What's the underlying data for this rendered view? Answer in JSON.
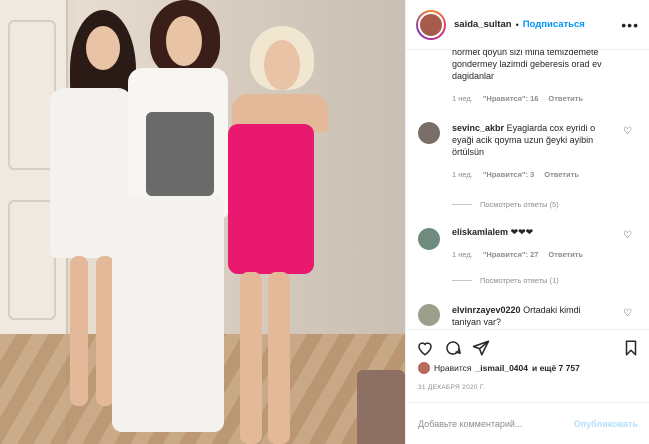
{
  "post": {
    "username": "saida_sultan",
    "follow_label": "Подписаться",
    "more_icon": "ellipsis-icon"
  },
  "comments": [
    {
      "text": "hormet qoyun sizi mina temizdemete gondermey lazimdi geberesis orad ev dagidanlar",
      "meta": {
        "age": "1 нед.",
        "likes": "\"Нравится\": 16",
        "reply": "Ответить"
      }
    },
    {
      "username": "sevinc_akbr",
      "text": "Eyaglarda cox eyridi o eyaği acik qoyma uzun ğeyki ayibin örtülsün",
      "meta": {
        "age": "1 нед.",
        "likes": "\"Нравится\": 3",
        "reply": "Ответить"
      },
      "replies": "Посмотреть ответы (5)"
    },
    {
      "username": "eliskamlalem",
      "text": "❤❤❤",
      "meta": {
        "age": "1 нед.",
        "likes": "\"Нравится\": 27",
        "reply": "Ответить"
      },
      "replies": "Посмотреть ответы (1)"
    },
    {
      "username": "elvinrzayev0220",
      "text": "Ortadaki kimdi taniyan var?"
    }
  ],
  "likes": {
    "prefix": "Нравится",
    "user": "_ismail_0404",
    "suffix": "и ещё 7 757"
  },
  "date": "31 ДЕКАБРЯ 2020 Г.",
  "add_comment": {
    "placeholder": "Добавьте комментарий...",
    "publish_label": "Опубликовать"
  },
  "colors": {
    "accent": "#0095f6",
    "publish_disabled": "#b2dffc",
    "meta_gray": "#8e8e8e",
    "dress_pink": "#e8196f"
  }
}
